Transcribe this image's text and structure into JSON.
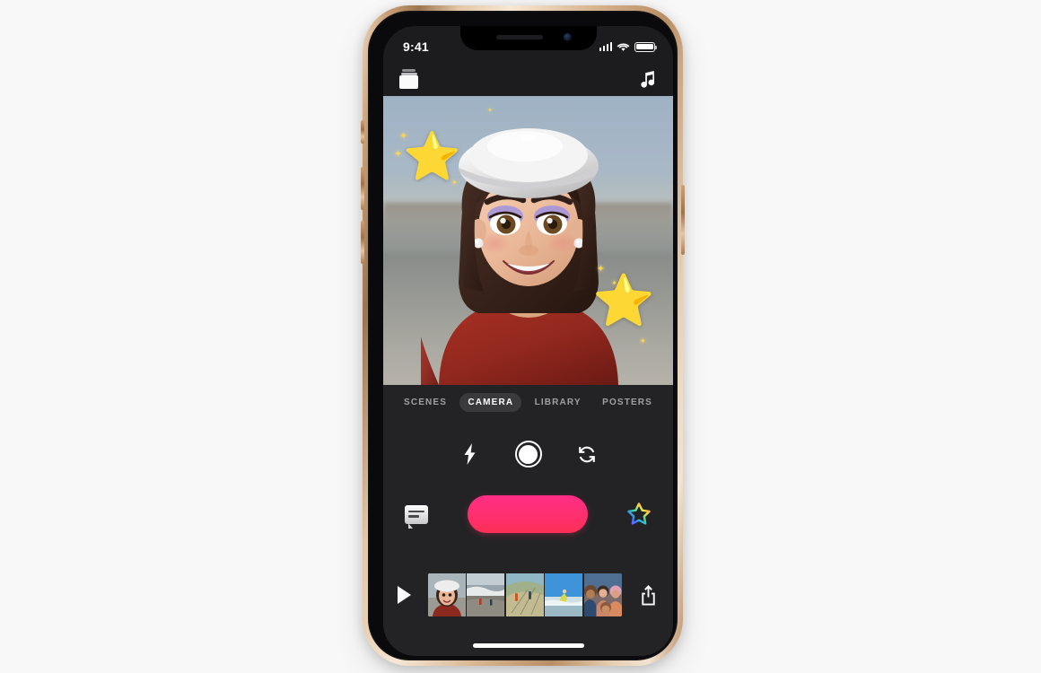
{
  "device": {
    "name": "iPhone XS",
    "frame_finish": "gold",
    "background_color": "#f8f8f8"
  },
  "status_bar": {
    "time": "9:41",
    "signal_icon": "cellular-bars-icon",
    "signal_bars": 4,
    "wifi_icon": "wifi-icon",
    "battery_icon": "battery-full-icon",
    "battery_level": 100
  },
  "app": {
    "name": "Clips",
    "topbar": {
      "left_icon": "projects-cards-icon",
      "right_icon": "music-note-icon"
    }
  },
  "viewfinder": {
    "description": "Memoji selfie on a beach background",
    "subject": "memoji-woman-white-beret-red-shirt",
    "background_scene": "beach-shoreline-overcast",
    "stickers": [
      {
        "name": "star-sticker-left",
        "glyph": "⭐"
      },
      {
        "name": "star-sticker-right",
        "glyph": "⭐"
      }
    ]
  },
  "tabs": [
    {
      "id": "scenes",
      "label": "SCENES",
      "active": false
    },
    {
      "id": "camera",
      "label": "CAMERA",
      "active": true
    },
    {
      "id": "library",
      "label": "LIBRARY",
      "active": false
    },
    {
      "id": "posters",
      "label": "POSTERS",
      "active": false
    }
  ],
  "camera_controls": [
    {
      "id": "flash",
      "icon": "flash-bolt-icon",
      "label": "Flash"
    },
    {
      "id": "photo",
      "icon": "shutter-circle-icon",
      "label": "Capture"
    },
    {
      "id": "flip",
      "icon": "camera-flip-icon",
      "label": "Flip Camera"
    }
  ],
  "record_row": {
    "left_icon": "live-titles-bubble-icon",
    "record_button": {
      "name": "record-button",
      "label": "",
      "color_top": "#ff2d86",
      "color_bottom": "#fb2f55"
    },
    "right_icon": "effects-star-icon"
  },
  "filmstrip": {
    "play_icon": "play-triangle-icon",
    "share_icon": "share-up-arrow-icon",
    "clips": [
      {
        "id": "clip-1",
        "name": "memoji-selfie-thumbnail"
      },
      {
        "id": "clip-2",
        "name": "beach-waves-thumbnail"
      },
      {
        "id": "clip-3",
        "name": "sand-dune-people-thumbnail"
      },
      {
        "id": "clip-4",
        "name": "beach-jump-thumbnail"
      },
      {
        "id": "clip-5",
        "name": "group-selfie-thumbnail"
      }
    ]
  },
  "home_indicator": {
    "name": "home-indicator"
  }
}
